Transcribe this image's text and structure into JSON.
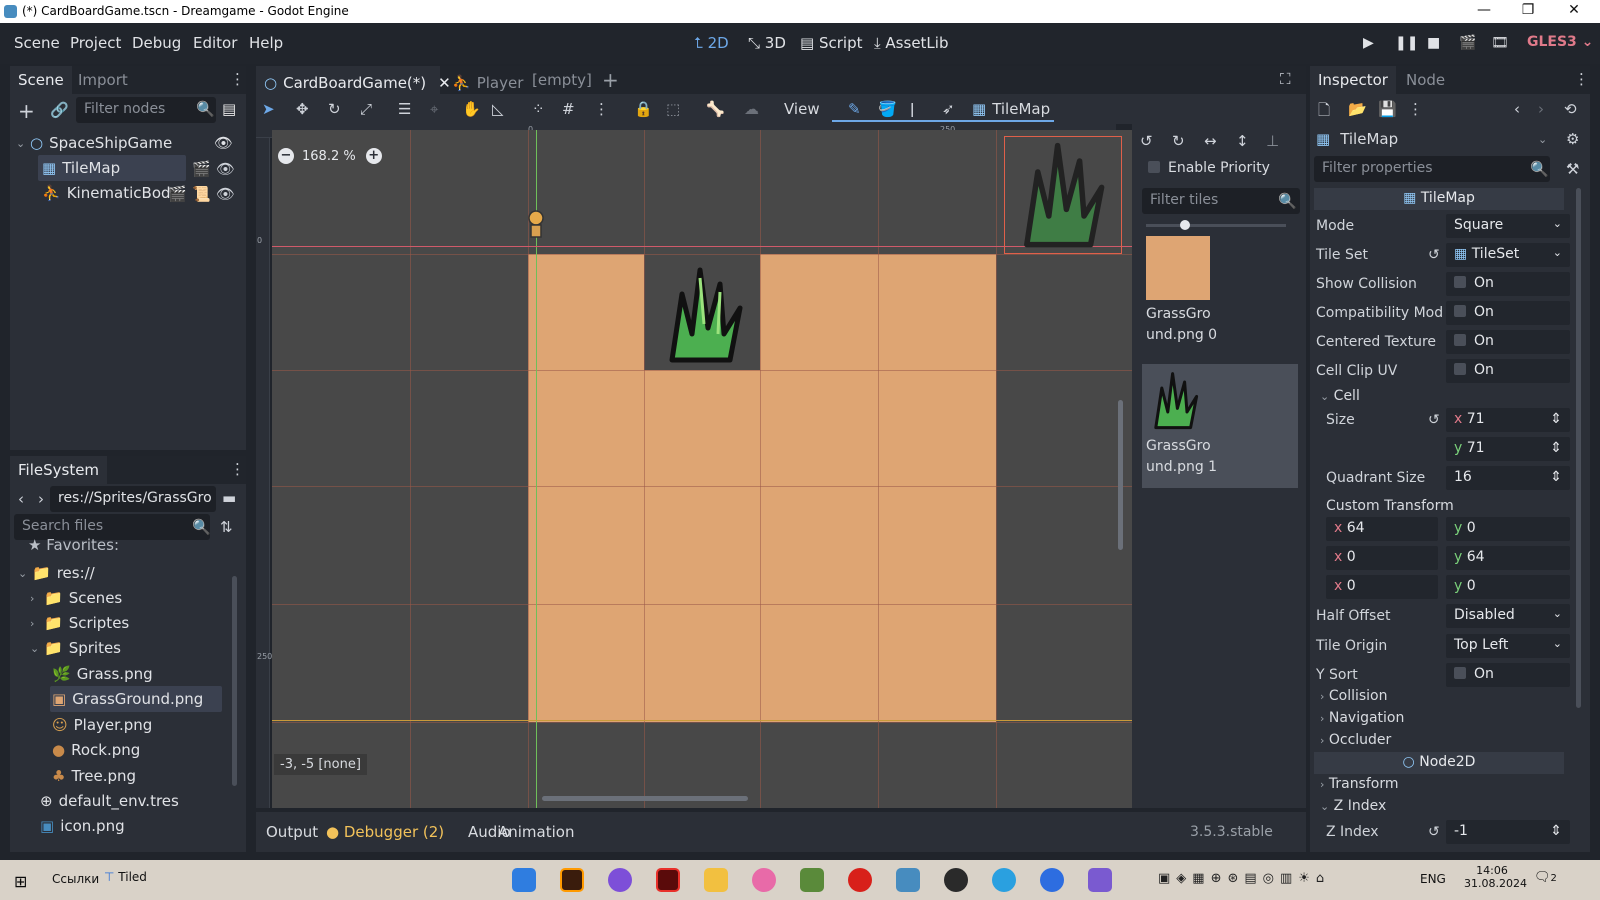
{
  "window": {
    "title": "(*) CardBoardGame.tscn - Dreamgame - Godot Engine",
    "minimize": "—",
    "maximize": "❐",
    "close": "✕"
  },
  "menu": {
    "items": [
      "Scene",
      "Project",
      "Debug",
      "Editor",
      "Help"
    ],
    "workspaces": [
      "2D",
      "3D",
      "Script",
      "AssetLib"
    ],
    "renderer": "GLES3"
  },
  "scene_dock": {
    "tabs": [
      "Scene",
      "Import"
    ],
    "filter_placeholder": "Filter nodes",
    "nodes": [
      "SpaceShipGame",
      "TileMap",
      "KinematicBody"
    ]
  },
  "filesystem_dock": {
    "tab": "FileSystem",
    "path": "res://Sprites/GrassGro",
    "search_placeholder": "Search files",
    "favorites": "Favorites:",
    "tree": {
      "root": "res://",
      "scenes": "Scenes",
      "scriptes": "Scriptes",
      "sprites": "Sprites",
      "files": [
        "Grass.png",
        "GrassGround.png",
        "Player.png",
        "Rock.png",
        "Tree.png"
      ],
      "default_env": "default_env.tres",
      "icon": "icon.png"
    }
  },
  "editor_tabs": {
    "tabs": [
      "CardBoardGame(*)",
      "Player",
      "[empty]"
    ]
  },
  "toolbar": {
    "view": "View",
    "tilemap": "TileMap"
  },
  "viewport": {
    "zoom": "168.2 %",
    "ruler_0": "0",
    "ruler_250": "250",
    "status": "-3, -5 [none]"
  },
  "tile_palette": {
    "enable_priority": "Enable Priority",
    "filter_placeholder": "Filter tiles",
    "tiles": [
      {
        "line1": "GrassGro",
        "line2": "und.png 0"
      },
      {
        "line1": "GrassGro",
        "line2": "und.png 1"
      }
    ]
  },
  "inspector": {
    "tabs": [
      "Inspector",
      "Node"
    ],
    "object": "TileMap",
    "filter_placeholder": "Filter properties",
    "section": "TileMap",
    "mode_label": "Mode",
    "mode_value": "Square",
    "tileset_label": "Tile Set",
    "tileset_value": "TileSet",
    "show_collision": "Show Collision",
    "compat_mode": "Compatibility Mod",
    "centered_texture": "Centered Texture",
    "cell_clip_uv": "Cell Clip UV",
    "on": "On",
    "cell": "Cell",
    "size_label": "Size",
    "size_x": "71",
    "size_y": "71",
    "quadrant_label": "Quadrant Size",
    "quadrant_value": "16",
    "custom_transform": "Custom Transform",
    "transform": [
      [
        "64",
        "0"
      ],
      [
        "0",
        "64"
      ],
      [
        "0",
        "0"
      ]
    ],
    "half_offset_label": "Half Offset",
    "half_offset_value": "Disabled",
    "tile_origin_label": "Tile Origin",
    "tile_origin_value": "Top Left",
    "y_sort": "Y Sort",
    "collision": "Collision",
    "navigation": "Navigation",
    "occluder": "Occluder",
    "node2d": "Node2D",
    "transform_section": "Transform",
    "z_index_section": "Z Index",
    "z_index_label": "Z Index",
    "z_index_value": "-1"
  },
  "bottom_panel": {
    "tabs": [
      "Output",
      "Debugger (2)",
      "Audio",
      "Animation"
    ],
    "version": "3.5.3.stable"
  },
  "taskbar": {
    "links": "Ссылки",
    "tiled": "Tiled",
    "lang": "ENG",
    "time": "14:06",
    "date": "31.08.2024",
    "notif": "2"
  }
}
